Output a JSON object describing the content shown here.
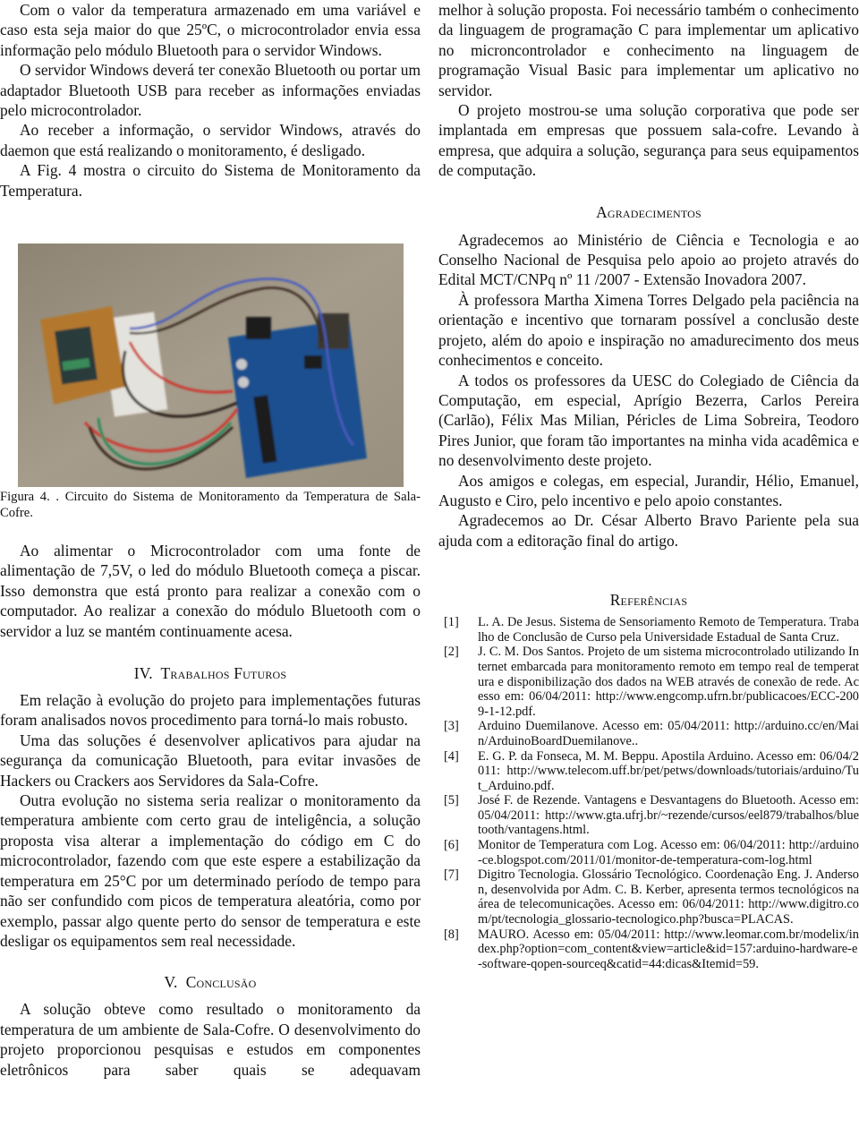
{
  "left_column": {
    "paragraphs_top": [
      "Com o valor da temperatura armazenado em uma variável e caso esta seja maior do que 25ºC, o microcontrolador envia essa informação pelo módulo Bluetooth para o servidor Windows.",
      "O servidor Windows deverá ter conexão Bluetooth ou portar um adaptador Bluetooth USB para receber as informações enviadas pelo microcontrolador.",
      "Ao receber a informação, o servidor Windows, através do daemon que está realizando o monitoramento, é desligado.",
      "A Fig. 4 mostra o circuito do Sistema de Monitoramento da Temperatura."
    ],
    "figure": {
      "alt": "Foto do circuito: placa Arduino azul conectada por fios a um módulo Bluetooth sobre protoboard",
      "caption": "Figura 4. . Circuito do Sistema de Monitoramento da Temperatura de Sala-Cofre."
    },
    "paragraph_after_figure": "Ao alimentar o Microcontrolador com uma fonte de alimentação de 7,5V, o led do módulo Bluetooth começa a piscar. Isso demonstra que está pronto para realizar a conexão com o computador. Ao realizar a conexão do módulo Bluetooth com o servidor a luz se mantém continuamente acesa.",
    "section_iv": {
      "number": "IV.",
      "title": "Trabalhos Futuros",
      "paragraphs": [
        "Em relação à evolução do projeto para implementações futuras foram analisados novos procedimento para torná-lo mais robusto.",
        "Uma das soluções é desenvolver aplicativos para ajudar na segurança da comunicação Bluetooth, para evitar invasões de Hackers ou Crackers aos Servidores da Sala-Cofre.",
        "Outra evolução no sistema seria realizar o monitoramento da temperatura ambiente com certo grau de inteligência, a solução proposta visa alterar a implementação do código em C do microcontrolador, fazendo com que este espere a estabilização da temperatura em 25°C por um determinado período de tempo para não ser confundido com picos de temperatura aleatória, como por exemplo, passar algo quente perto do sensor de temperatura e este desligar os equipamentos sem real necessidade."
      ]
    },
    "section_v": {
      "number": "V.",
      "title": "Conclusão",
      "paragraph_start": "A solução obteve como resultado o monitoramento da temperatura de um ambiente de Sala-Cofre. O desenvolvimento do projeto proporcionou pesquisas e estudos em componentes eletrônicos para saber quais se adequavam"
    }
  },
  "right_column": {
    "conclusion_continued": "melhor à solução proposta. Foi necessário também o conhecimento da linguagem de programação C para implementar um aplicativo no microncontrolador e conhecimento na linguagem de programação Visual Basic para implementar um aplicativo no servidor.",
    "conclusion_paragraph_2": "O projeto mostrou-se uma solução corporativa que pode ser implantada em empresas que possuem sala-cofre. Levando à empresa, que adquira a solução, segurança para seus equipamentos de computação.",
    "acknowledgements": {
      "title": "Agradecimentos",
      "paragraphs": [
        "Agradecemos ao Ministério de Ciência e Tecnologia e ao Conselho Nacional de Pesquisa pelo apoio ao projeto através do Edital MCT/CNPq nº 11 /2007 - Extensão Inovadora 2007.",
        "À professora Martha Ximena Torres Delgado pela paciência na orientação e incentivo que tornaram possível a conclusão deste projeto, além do apoio e inspiração no amadurecimento dos meus conhecimentos e conceito.",
        "A todos os professores da UESC do Colegiado de Ciência da Computação, em especial, Aprígio Bezerra, Carlos Pereira (Carlão), Félix Mas Milian, Péricles de Lima Sobreira, Teodoro Pires Junior, que foram tão importantes na minha vida acadêmica e no desenvolvimento deste projeto.",
        "Aos amigos e colegas, em especial, Jurandir, Hélio, Emanuel, Augusto e Ciro, pelo incentivo e pelo apoio constantes.",
        "Agradecemos ao Dr. César Alberto Bravo Pariente pela sua ajuda com a editoração final do artigo."
      ]
    },
    "references": {
      "title": "Referências",
      "items": [
        {
          "num": "[1]",
          "text": "L. A. De Jesus. Sistema de Sensoriamento Remoto de Temperatura. Trabalho de Conclusão de Curso pela Universidade Estadual de Santa Cruz."
        },
        {
          "num": "[2]",
          "text": "J. C. M. Dos Santos. Projeto de um sistema microcontrolado utilizando Internet embarcada para monitoramento remoto em tempo real de temperatura e disponibilização dos dados na WEB através de conexão de rede. Acesso em: 06/04/2011: http://www.engcomp.ufrn.br/publicacoes/ECC-2009-1-12.pdf."
        },
        {
          "num": "[3]",
          "text": "Arduino Duemilanove. Acesso em: 05/04/2011: http://arduino.cc/en/Main/ArduinoBoardDuemilanove.."
        },
        {
          "num": "[4]",
          "text": "E. G. P. da Fonseca, M. M. Beppu. Apostila Arduino. Acesso em: 06/04/2011: http://www.telecom.uff.br/pet/petws/downloads/tutoriais/arduino/Tut_Arduino.pdf."
        },
        {
          "num": "[5]",
          "text": "José F. de Rezende. Vantagens e Desvantagens do Bluetooth. Acesso em: 05/04/2011: http://www.gta.ufrj.br/~rezende/cursos/eel879/trabalhos/bluetooth/vantagens.html."
        },
        {
          "num": "[6]",
          "text": "Monitor de Temperatura com Log. Acesso em: 06/04/2011: http://arduino-ce.blogspot.com/2011/01/monitor-de-temperatura-com-log.html"
        },
        {
          "num": "[7]",
          "text": "Digitro Tecnologia. Glossário Tecnológico. Coordenação Eng. J. Anderson, desenvolvida por Adm. C. B. Kerber, apresenta termos tecnológicos na área de telecomunicações. Acesso em: 06/04/2011: http://www.digitro.com/pt/tecnologia_glossario-tecnologico.php?busca=PLACAS."
        },
        {
          "num": "[8]",
          "text": "MAURO. Acesso em: 05/04/2011: http://www.leomar.com.br/modelix/index.php?option=com_content&view=article&id=157:arduino-hardware-e-software-qopen-sourceq&catid=44:dicas&Itemid=59."
        }
      ]
    }
  }
}
